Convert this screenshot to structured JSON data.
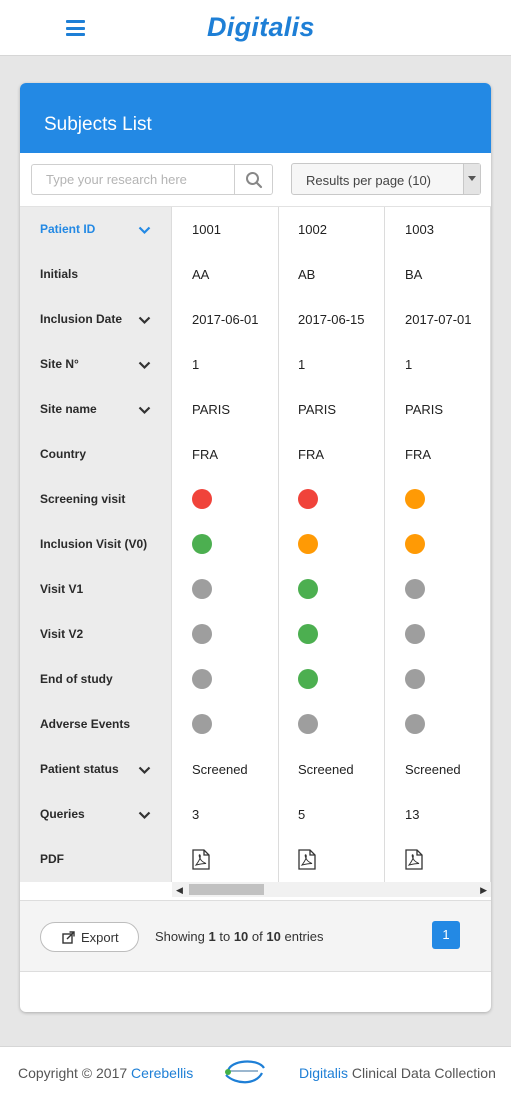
{
  "app": {
    "logo_text": "Digitalis",
    "brand_color": "#1e7fd6"
  },
  "card": {
    "title": "Subjects List"
  },
  "toolbar": {
    "search_placeholder": "Type your research here",
    "results_per_page": "Results per page (10)"
  },
  "columns": [
    {
      "label": "Patient ID",
      "sortable": true,
      "active": true
    },
    {
      "label": "Initials",
      "sortable": false
    },
    {
      "label": "Inclusion Date",
      "sortable": true
    },
    {
      "label": "Site N°",
      "sortable": true
    },
    {
      "label": "Site name",
      "sortable": true
    },
    {
      "label": "Country",
      "sortable": false
    },
    {
      "label": "Screening visit",
      "sortable": false
    },
    {
      "label": "Inclusion Visit (V0)",
      "sortable": false
    },
    {
      "label": "Visit V1",
      "sortable": false
    },
    {
      "label": "Visit V2",
      "sortable": false
    },
    {
      "label": "End of study",
      "sortable": false
    },
    {
      "label": "Adverse Events",
      "sortable": false
    },
    {
      "label": "Patient status",
      "sortable": true
    },
    {
      "label": "Queries",
      "sortable": true
    },
    {
      "label": "PDF",
      "sortable": false
    }
  ],
  "status_colors": {
    "red": "#f0433a",
    "orange": "#ff9a05",
    "green": "#4caf50",
    "grey": "#9e9e9e"
  },
  "subjects": [
    {
      "patient_id": "1001",
      "initials": "AA",
      "inclusion_date": "2017-06-01",
      "site_no": "1",
      "site_name": "PARIS",
      "country": "FRA",
      "screening_visit": "red",
      "inclusion_visit": "green",
      "visit_v1": "grey",
      "visit_v2": "grey",
      "end_of_study": "grey",
      "adverse_events": "grey",
      "patient_status": "Screened",
      "queries": "3",
      "pdf_icon": "pdf-icon"
    },
    {
      "patient_id": "1002",
      "initials": "AB",
      "inclusion_date": "2017-06-15",
      "site_no": "1",
      "site_name": "PARIS",
      "country": "FRA",
      "screening_visit": "red",
      "inclusion_visit": "orange",
      "visit_v1": "green",
      "visit_v2": "green",
      "end_of_study": "green",
      "adverse_events": "grey",
      "patient_status": "Screened",
      "queries": "5",
      "pdf_icon": "pdf-icon"
    },
    {
      "patient_id": "1003",
      "initials": "BA",
      "inclusion_date": "2017-07-01",
      "site_no": "1",
      "site_name": "PARIS",
      "country": "FRA",
      "screening_visit": "orange",
      "inclusion_visit": "orange",
      "visit_v1": "grey",
      "visit_v2": "grey",
      "end_of_study": "grey",
      "adverse_events": "grey",
      "patient_status": "Screened",
      "queries": "13",
      "pdf_icon": "pdf-icon"
    }
  ],
  "footer_bar": {
    "export_label": "Export",
    "showing_prefix": "Showing",
    "showing_from": "1",
    "showing_to_word": "to",
    "showing_to": "10",
    "showing_of_word": "of",
    "showing_total": "10",
    "showing_suffix": "entries",
    "current_page": "1"
  },
  "site_footer": {
    "copyright_text": "Copyright © 2017",
    "company_link": "Cerebellis",
    "product_link": "Digitalis",
    "tagline_rest": "Clinical Data Collection"
  }
}
